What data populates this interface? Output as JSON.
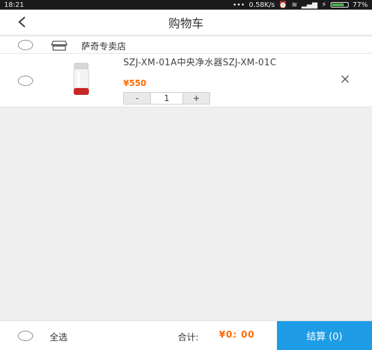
{
  "status_bar": {
    "time": "18:21",
    "speed": "0.58K/s",
    "battery": "77%",
    "battery_level": 0.77
  },
  "header": {
    "back_icon": "back-arrow-icon",
    "title": "购物车"
  },
  "shop": {
    "icon": "store-icon",
    "name": "萨奇专卖店"
  },
  "cart_item": {
    "name": "SZJ-XM-01A中央净水器SZJ-XM-01C",
    "price": "¥550",
    "quantity": "1",
    "minus_label": "-",
    "plus_label": "+",
    "delete_icon": "close-icon"
  },
  "footer": {
    "select_all": "全选",
    "total_label": "合计:",
    "total_value": "¥0: 00",
    "checkout": "结算 (0)"
  },
  "colors": {
    "accent": "#1e9ce6",
    "price": "#ff6a00",
    "background": "#efefef"
  }
}
